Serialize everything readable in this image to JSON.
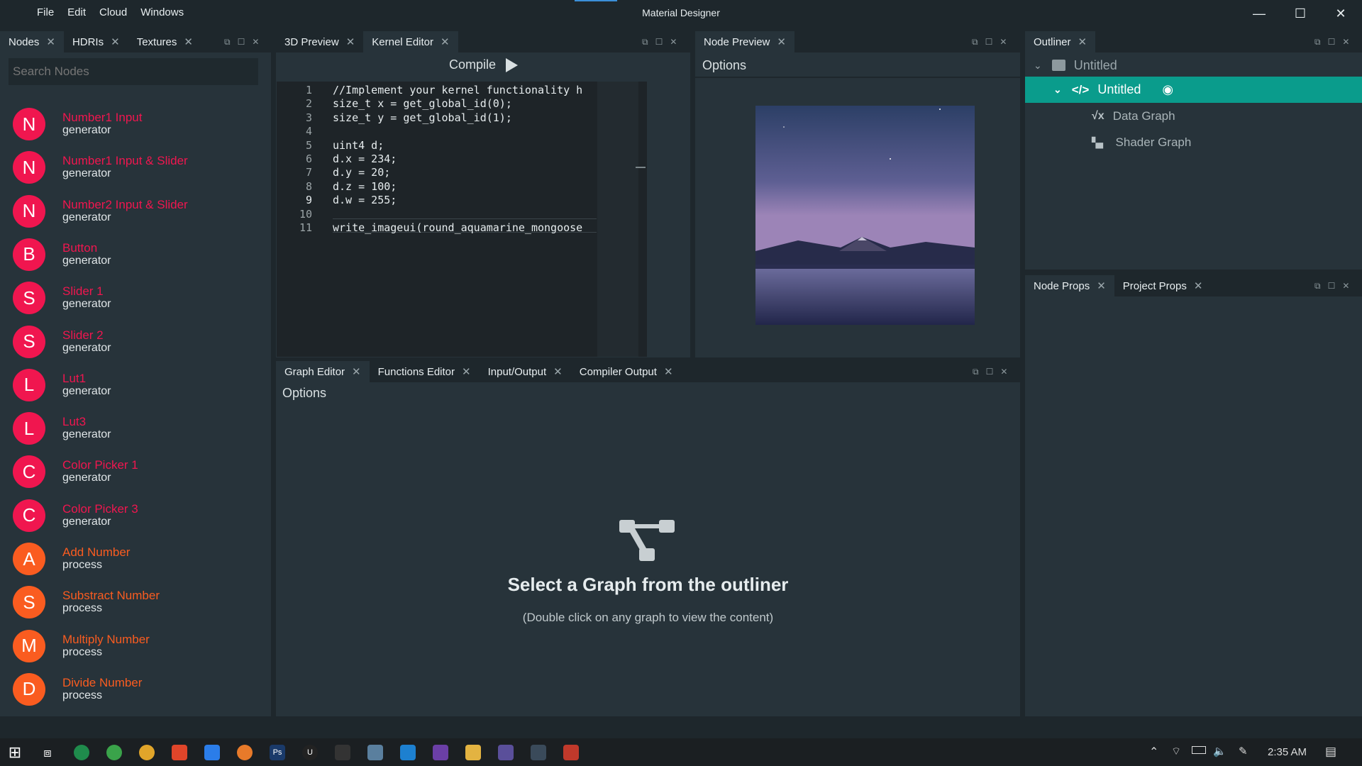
{
  "menu": {
    "file": "File",
    "edit": "Edit",
    "cloud": "Cloud",
    "windows": "Windows"
  },
  "app_title": "Material Designer",
  "window_controls": {
    "minimize": "—",
    "maximize": "☐",
    "close": "✕"
  },
  "left_tabs": [
    {
      "label": "Nodes",
      "close": "✕"
    },
    {
      "label": "HDRIs",
      "close": "✕"
    },
    {
      "label": "Textures",
      "close": "✕"
    }
  ],
  "search": {
    "placeholder": "Search Nodes"
  },
  "nodes": [
    {
      "letter": "N",
      "name": "Number1 Input",
      "category": "generator"
    },
    {
      "letter": "N",
      "name": "Number1 Input & Slider",
      "category": "generator"
    },
    {
      "letter": "N",
      "name": "Number2 Input & Slider",
      "category": "generator"
    },
    {
      "letter": "B",
      "name": "Button",
      "category": "generator"
    },
    {
      "letter": "S",
      "name": "Slider 1",
      "category": "generator"
    },
    {
      "letter": "S",
      "name": "Slider 2",
      "category": "generator"
    },
    {
      "letter": "L",
      "name": "Lut1",
      "category": "generator"
    },
    {
      "letter": "L",
      "name": "Lut3",
      "category": "generator"
    },
    {
      "letter": "C",
      "name": "Color Picker 1",
      "category": "generator"
    },
    {
      "letter": "C",
      "name": "Color Picker 3",
      "category": "generator"
    },
    {
      "letter": "A",
      "name": "Add Number",
      "category": "process"
    },
    {
      "letter": "S",
      "name": "Substract Number",
      "category": "process"
    },
    {
      "letter": "M",
      "name": "Multiply Number",
      "category": "process"
    },
    {
      "letter": "D",
      "name": "Divide Number",
      "category": "process"
    }
  ],
  "colors": {
    "generator": "#f0164f",
    "process": "#fa5c20",
    "accent": "#0a9c8c",
    "panel": "#27333a",
    "bg": "#1e272c"
  },
  "editor_tabs": [
    {
      "label": "3D Preview",
      "close": "✕"
    },
    {
      "label": "Kernel Editor",
      "close": "✕"
    }
  ],
  "compile": {
    "label": "Compile",
    "icon": "play-icon"
  },
  "code_lines": [
    {
      "n": "1",
      "t": "//Implement your kernel functionality h"
    },
    {
      "n": "2",
      "t": "size_t x = get_global_id(0);"
    },
    {
      "n": "3",
      "t": "size_t y = get_global_id(1);"
    },
    {
      "n": "4",
      "t": ""
    },
    {
      "n": "5",
      "t": "uint4 d;"
    },
    {
      "n": "6",
      "t": "d.x = 234;"
    },
    {
      "n": "7",
      "t": "d.y = 20;"
    },
    {
      "n": "8",
      "t": "d.z = 100;"
    },
    {
      "n": "9",
      "t": "d.w = 255;"
    },
    {
      "n": "10",
      "t": ""
    },
    {
      "n": "11",
      "t": "write_imageui(round_aquamarine_mongoose"
    }
  ],
  "preview_tabs": [
    {
      "label": "Node Preview",
      "close": "✕"
    }
  ],
  "preview_options": "Options",
  "outliner_tabs": [
    {
      "label": "Outliner",
      "close": "✕"
    }
  ],
  "outliner": {
    "root": "Untitled",
    "selected": "Untitled",
    "children": [
      "Data Graph",
      "Shader Graph"
    ]
  },
  "props_tabs": [
    {
      "label": "Node Props",
      "close": "✕"
    },
    {
      "label": "Project Props",
      "close": "✕"
    }
  ],
  "bottom_tabs": [
    {
      "label": "Graph Editor",
      "close": "✕"
    },
    {
      "label": "Functions Editor",
      "close": "✕"
    },
    {
      "label": "Input/Output",
      "close": "✕"
    },
    {
      "label": "Compiler Output",
      "close": "✕"
    }
  ],
  "graph": {
    "options": "Options",
    "title": "Select a Graph from the outliner",
    "subtitle": "(Double click on any graph to view the content)"
  },
  "taskbar": {
    "time": "2:35 AM"
  }
}
